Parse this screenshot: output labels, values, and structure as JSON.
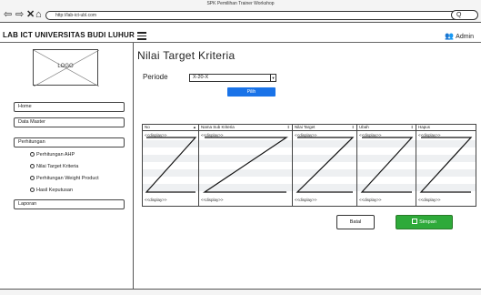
{
  "window": {
    "title": "SPK Pemilihan Trainer Workshop"
  },
  "browser": {
    "url": "http://lab-ict-ubl.com",
    "search_value": "Q",
    "nav_icons": [
      "back-arrow-icon",
      "forward-arrow-icon",
      "close-icon",
      "home-icon"
    ]
  },
  "header": {
    "brand": "LAB ICT UNIVERSITAS BUDI LUHUR",
    "user_label": "Admin"
  },
  "sidebar": {
    "logo_text": "LOGO",
    "items": [
      {
        "label": "Home"
      },
      {
        "label": "Data Master"
      },
      {
        "label": "Perhitungan"
      },
      {
        "label": "Laporan"
      }
    ],
    "subitems": [
      {
        "label": "Perhitungan AHP"
      },
      {
        "label": "Nilai Target Kriteria"
      },
      {
        "label": "Perhitungan Weight Product"
      },
      {
        "label": "Hasil Keputusan"
      }
    ]
  },
  "main": {
    "title": "Nilai Target Kriteria",
    "periode_label": "Periode",
    "periode_value": "X-20-X",
    "pilih_label": "Pilih",
    "table": {
      "columns": [
        "No",
        "Nama Sub Kriteria",
        "Nilai Target",
        "Ubah",
        "Hapus"
      ],
      "placeholder": "<<display>>"
    },
    "batal_label": "Batal",
    "simpan_label": "Simpan"
  },
  "colors": {
    "primary": "#1a73e8",
    "success": "#2eaa3a"
  }
}
